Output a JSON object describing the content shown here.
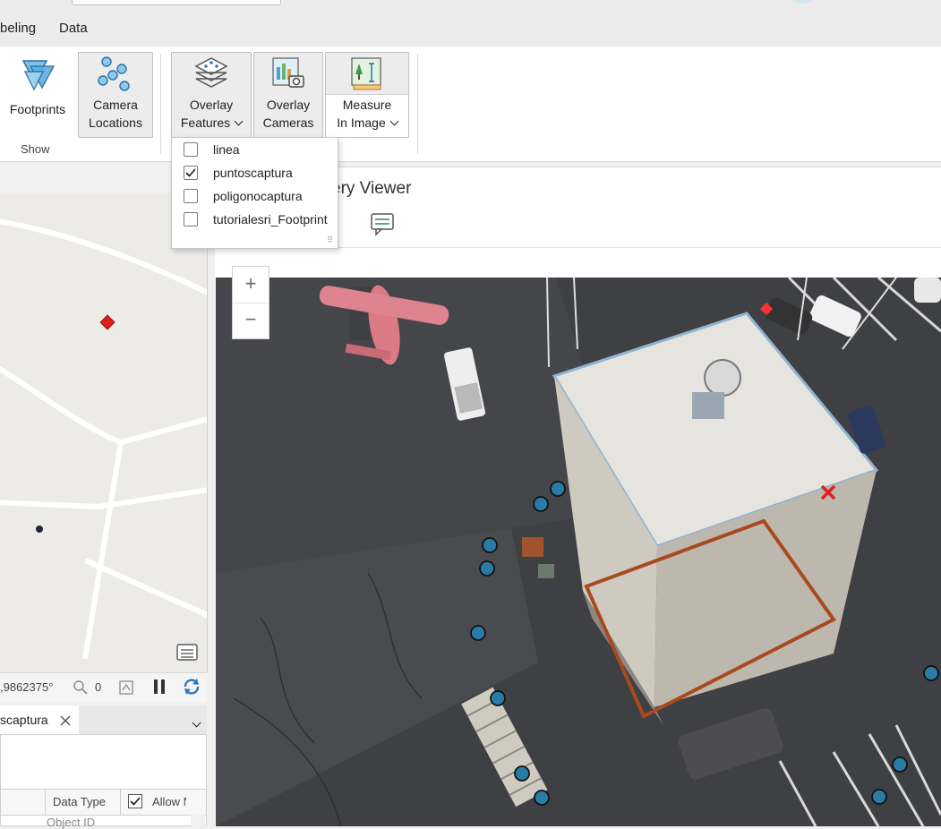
{
  "menu": {
    "tabs": [
      {
        "label": "beling"
      },
      {
        "label": "Data"
      }
    ]
  },
  "ribbon": {
    "footprints_label": "Footprints",
    "camera_locations_label_1": "Camera",
    "camera_locations_label_2": "Locations",
    "group_show_label": "Show",
    "overlay_features_label_1": "Overlay",
    "overlay_features_label_2": "Features",
    "overlay_cameras_label_1": "Overlay",
    "overlay_cameras_label_2": "Cameras",
    "measure_label_1": "Measure",
    "measure_label_2": "In Image"
  },
  "overlay_dropdown": {
    "items": [
      {
        "label": "linea",
        "checked": false
      },
      {
        "label": "puntoscaptura",
        "checked": true
      },
      {
        "label": "poligonocaptura",
        "checked": false
      },
      {
        "label": "tutorialesri_Footprint",
        "checked": false
      }
    ]
  },
  "viewer": {
    "title_fragment": "ery Viewer"
  },
  "zoom": {
    "in": "+",
    "out": "−"
  },
  "map_status": {
    "coordinate": ",9862375°",
    "selected_count": "0"
  },
  "attribute_table": {
    "tab_label": "scaptura",
    "col_data_type": "Data Type",
    "col_allow": "Allow N",
    "first_row_fragment": "Object ID"
  },
  "colors": {
    "accent_blue": "#2f78b7",
    "point_fill": "#2a7ca8",
    "polygon_brown": "#a84a1f",
    "map_red": "#e02020"
  }
}
